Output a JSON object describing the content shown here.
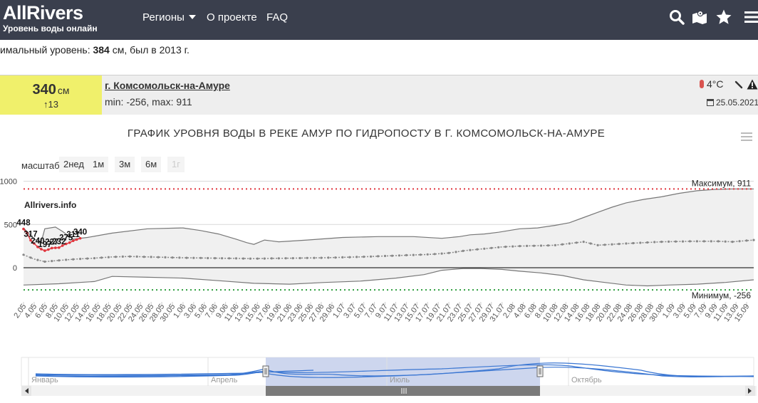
{
  "header": {
    "brand": "AllRivers",
    "tagline": "Уровень воды онлайн",
    "nav": [
      "Регионы",
      "О проекте",
      "FAQ"
    ],
    "icons": [
      "search-icon",
      "map-icon",
      "star-icon",
      "menu-icon"
    ]
  },
  "record": {
    "prefix": "имальный уровень: ",
    "value": "384",
    "suffix": " см, был в 2013 г."
  },
  "gauge": {
    "level": "340",
    "unit": "см",
    "change": "↑13",
    "station": "г. Комсомольск-на-Амуре",
    "range": "min: -256, max: 911",
    "temperature": "4°С",
    "date": "25.05.2021",
    "colors": {
      "level_bg": "#f0f06b",
      "row_bg": "#eeeeee"
    }
  },
  "zoom": {
    "label": "масштаб",
    "buttons": [
      "2нед",
      "1м",
      "3м",
      "6м",
      "1г"
    ]
  },
  "chart_data": {
    "type": "line",
    "title": "ГРАФИК УРОВНЯ ВОДЫ В РЕКЕ АМУР ПО ГИДРОПОСТУ В Г. КОМСОМОЛЬСК-НА-АМУРЕ",
    "watermark": "Allrivers.info",
    "y_ticks": [
      "1000",
      "500",
      "0"
    ],
    "ylim": [
      -460,
      1000
    ],
    "x_tick_labels": [
      "2.05",
      "4.05",
      "6.05",
      "8.05",
      "10.05",
      "12.05",
      "14.05",
      "16.05",
      "18.05",
      "20.05",
      "22.05",
      "24.05",
      "26.05",
      "28.05",
      "30.05",
      "1.06",
      "3.06",
      "5.06",
      "7.06",
      "9.06",
      "11.06",
      "13.06",
      "15.06",
      "17.06",
      "19.06",
      "21.06",
      "23.06",
      "25.06",
      "27.06",
      "29.06",
      "1.07",
      "3.07",
      "5.07",
      "7.07",
      "9.07",
      "11.07",
      "13.07",
      "15.07",
      "17.07",
      "19.07",
      "21.07",
      "23.07",
      "25.07",
      "27.07",
      "29.07",
      "31.07",
      "2.08",
      "4.08",
      "6.08",
      "8.08",
      "10.08",
      "12.08",
      "14.08",
      "16.08",
      "18.08",
      "20.08",
      "22.08",
      "24.08",
      "26.08",
      "28.08",
      "30.08",
      "1.09",
      "3.09",
      "5.09",
      "7.09",
      "9.09",
      "11.09",
      "13.09",
      "15.09"
    ],
    "plot_lines": [
      {
        "label": "Максимум, 911",
        "value": 911,
        "color": "#e0353d"
      },
      {
        "label": "Минимум, -256",
        "value": -256,
        "color": "#2e9e3e"
      }
    ],
    "current_series": {
      "day_index": [
        0,
        2,
        4,
        6,
        8,
        10,
        12,
        14,
        16,
        18,
        20,
        23
      ],
      "values": [
        448,
        317,
        240,
        197,
        227,
        232,
        275,
        311,
        340
      ],
      "labeled_days": [
        0,
        2,
        4,
        6,
        8,
        10,
        12,
        14,
        16
      ],
      "all_values": [
        448,
        400,
        317,
        280,
        240,
        215,
        197,
        210,
        227,
        230,
        232,
        255,
        275,
        290,
        311,
        325,
        340
      ],
      "color": "#e0353d"
    },
    "band_upper": [
      [
        0,
        460
      ],
      [
        3,
        330
      ],
      [
        5,
        300
      ],
      [
        6,
        450
      ],
      [
        9,
        470
      ],
      [
        11,
        420
      ],
      [
        14,
        330
      ],
      [
        18,
        350
      ],
      [
        25,
        400
      ],
      [
        35,
        450
      ],
      [
        45,
        460
      ],
      [
        50,
        430
      ],
      [
        55,
        390
      ],
      [
        60,
        330
      ],
      [
        63,
        290
      ],
      [
        65,
        270
      ],
      [
        68,
        320
      ],
      [
        72,
        300
      ],
      [
        80,
        320
      ],
      [
        90,
        350
      ],
      [
        100,
        360
      ],
      [
        110,
        360
      ],
      [
        118,
        340
      ],
      [
        123,
        360
      ],
      [
        126,
        380
      ],
      [
        130,
        390
      ],
      [
        134,
        410
      ],
      [
        140,
        450
      ],
      [
        145,
        460
      ],
      [
        150,
        490
      ],
      [
        154,
        520
      ],
      [
        158,
        580
      ],
      [
        162,
        640
      ],
      [
        166,
        700
      ],
      [
        170,
        750
      ],
      [
        175,
        790
      ],
      [
        180,
        820
      ],
      [
        185,
        860
      ],
      [
        190,
        890
      ],
      [
        195,
        905
      ],
      [
        200,
        911
      ],
      [
        206,
        911
      ]
    ],
    "band_lower": [
      [
        0,
        -200
      ],
      [
        10,
        -185
      ],
      [
        20,
        -160
      ],
      [
        25,
        -100
      ],
      [
        35,
        -110
      ],
      [
        45,
        -120
      ],
      [
        55,
        -150
      ],
      [
        65,
        -180
      ],
      [
        75,
        -190
      ],
      [
        85,
        -170
      ],
      [
        95,
        -155
      ],
      [
        105,
        -120
      ],
      [
        113,
        -80
      ],
      [
        118,
        -30
      ],
      [
        124,
        -10
      ],
      [
        129,
        -10
      ],
      [
        135,
        -20
      ],
      [
        140,
        -40
      ],
      [
        146,
        -60
      ],
      [
        152,
        -90
      ],
      [
        158,
        -140
      ],
      [
        164,
        -170
      ],
      [
        170,
        -200
      ],
      [
        176,
        -210
      ],
      [
        182,
        -200
      ],
      [
        190,
        -190
      ],
      [
        198,
        -170
      ],
      [
        206,
        -140
      ]
    ],
    "mean_series": [
      [
        0,
        150
      ],
      [
        3,
        100
      ],
      [
        6,
        70
      ],
      [
        10,
        85
      ],
      [
        15,
        100
      ],
      [
        20,
        110
      ],
      [
        25,
        125
      ],
      [
        30,
        130
      ],
      [
        35,
        125
      ],
      [
        45,
        115
      ],
      [
        55,
        110
      ],
      [
        65,
        105
      ],
      [
        75,
        110
      ],
      [
        85,
        115
      ],
      [
        95,
        125
      ],
      [
        105,
        140
      ],
      [
        115,
        155
      ],
      [
        120,
        170
      ],
      [
        125,
        200
      ],
      [
        130,
        220
      ],
      [
        135,
        240
      ],
      [
        140,
        250
      ],
      [
        146,
        255
      ],
      [
        150,
        260
      ],
      [
        154,
        280
      ],
      [
        158,
        300
      ],
      [
        162,
        260
      ],
      [
        166,
        270
      ],
      [
        170,
        280
      ],
      [
        175,
        290
      ],
      [
        180,
        300
      ],
      [
        188,
        305
      ],
      [
        196,
        305
      ],
      [
        200,
        300
      ],
      [
        206,
        320
      ]
    ],
    "navigator_labels": [
      "Январь",
      "Апрель",
      "Июль",
      "Октябрь"
    ],
    "colors": {
      "band": "#f0f0f0",
      "band_line": "#777777",
      "mean": "#888888",
      "navigator_line": "#3a76d2",
      "navigator_mask": "#c8d2ec"
    }
  }
}
